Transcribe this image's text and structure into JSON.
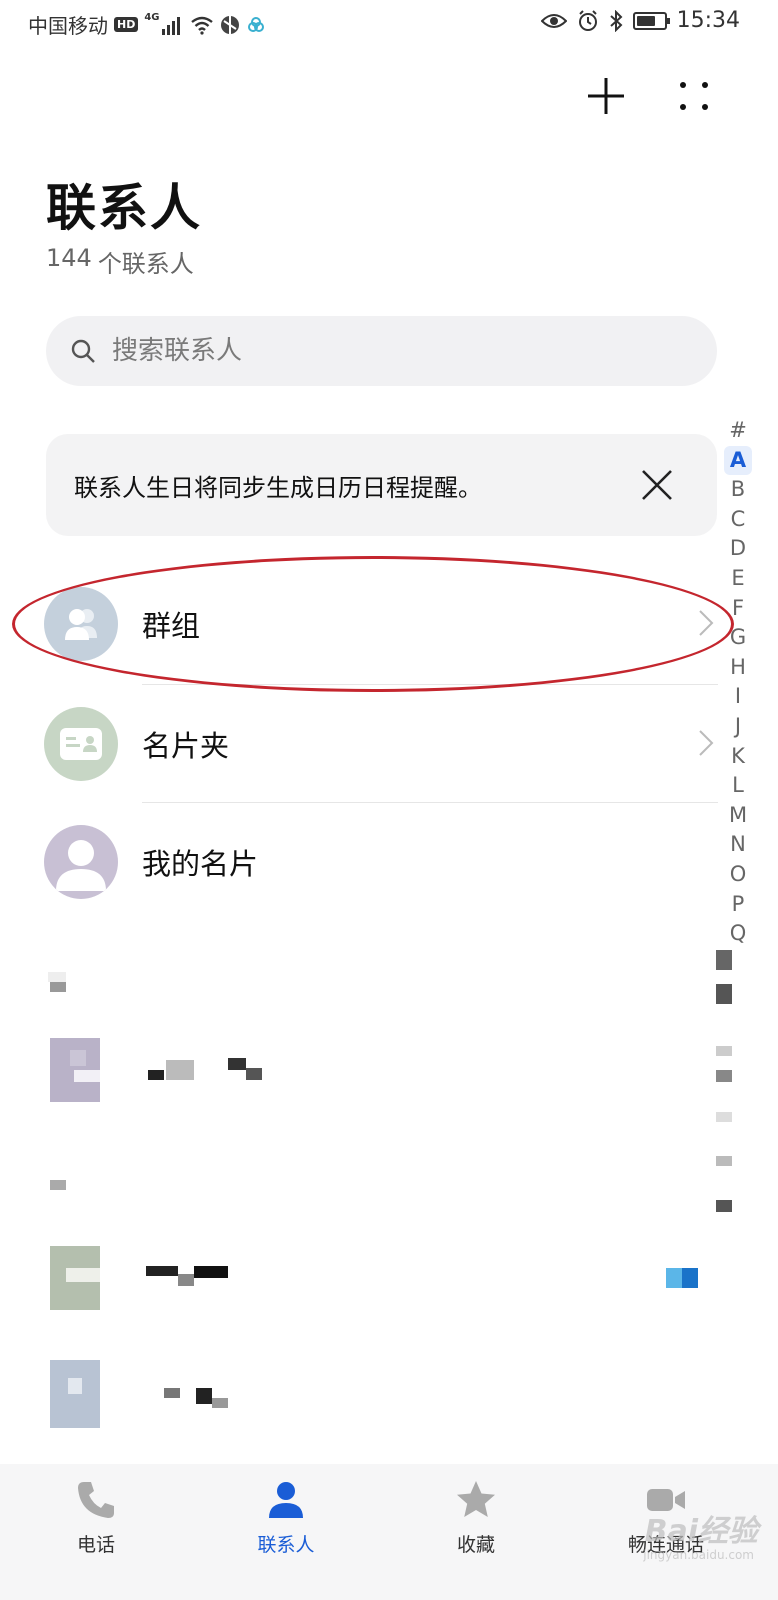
{
  "status_bar": {
    "carrier": "中国移动",
    "hd_label": "HD",
    "network": "4G",
    "time": "15:34",
    "battery_level": 0.7
  },
  "header": {
    "title": "联系人",
    "contact_count": "144",
    "count_suffix": "个联系人"
  },
  "search": {
    "placeholder": "搜索联系人"
  },
  "notice": {
    "text": "联系人生日将同步生成日历日程提醒。"
  },
  "entries": [
    {
      "label": "群组",
      "icon": "group-icon"
    },
    {
      "label": "名片夹",
      "icon": "business-card-icon"
    },
    {
      "label": "我的名片",
      "icon": "person-icon"
    }
  ],
  "alpha_index": [
    "#",
    "A",
    "B",
    "C",
    "D",
    "E",
    "F",
    "G",
    "H",
    "I",
    "J",
    "K",
    "L",
    "M",
    "N",
    "O",
    "P",
    "Q"
  ],
  "alpha_active": "A",
  "bottom_nav": [
    {
      "label": "电话",
      "icon": "phone-icon",
      "active": false
    },
    {
      "label": "联系人",
      "icon": "contacts-icon",
      "active": true
    },
    {
      "label": "收藏",
      "icon": "star-icon",
      "active": false
    },
    {
      "label": "畅连通话",
      "icon": "video-call-icon",
      "active": false
    }
  ],
  "watermark": {
    "text": "Bai经验",
    "sub": "jingyan.baidu.com"
  },
  "colors": {
    "accent": "#1a5dd6",
    "annotation_red": "#c4262e",
    "group_avatar": "#c4d0dc",
    "card_avatar": "#c7d6c5",
    "my_card_avatar": "#c8c0d4"
  }
}
